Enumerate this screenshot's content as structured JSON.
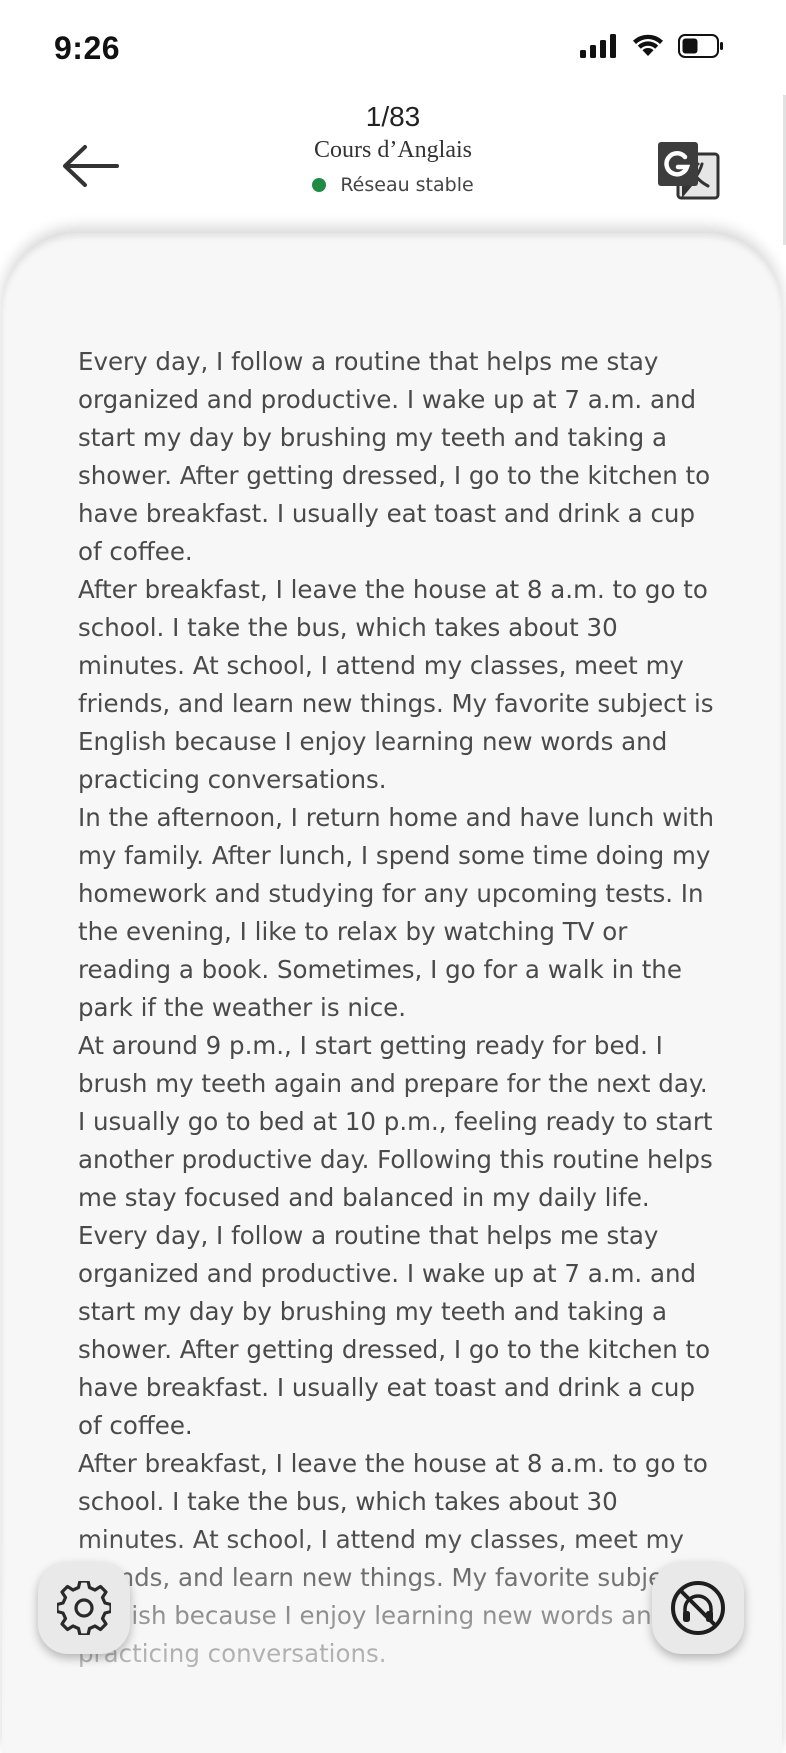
{
  "status_bar": {
    "time": "9:26",
    "icons": [
      "signal-icon",
      "wifi-icon",
      "battery-icon"
    ]
  },
  "header": {
    "page_counter": "1/83",
    "course_title": "Cours d’Anglais",
    "network_status": "Réseau stable",
    "network_status_color": "#1e8c45",
    "back_icon": "back-arrow-icon",
    "translate_icon": "google-translate-icon"
  },
  "reader": {
    "paragraphs": [
      "Every day, I follow a routine that helps me stay organized and productive. I wake up at 7 a.m. and start my day by brushing my teeth and taking a shower. After getting dressed, I go to the kitchen to have breakfast. I usually eat toast and drink a cup of coffee.",
      "After breakfast, I leave the house at 8 a.m. to go to school. I take the bus, which takes about 30 minutes. At school, I attend my classes, meet my friends, and learn new things. My favorite subject is English because I enjoy learning new words and practicing conversations.",
      "In the afternoon, I return home and have lunch with my family. After lunch, I spend some time doing my homework and studying for any upcoming tests. In the evening, I like to relax by watching TV or reading a book. Sometimes, I go for a walk in the park if the weather is nice.",
      "At around 9 p.m., I start getting ready for bed. I brush my teeth again and prepare for the next day. I usually go to bed at 10 p.m., feeling ready to start another productive day. Following this routine helps me stay focused and balanced in my daily life.",
      "Every day, I follow a routine that helps me stay organized and productive. I wake up at 7 a.m. and start my day by brushing my teeth and taking a shower. After getting dressed, I go to the kitchen to have breakfast. I usually eat toast and drink a cup of coffee.",
      "After breakfast, I leave the house at 8 a.m. to go to school. I take the bus, which takes about 30 minutes. At school, I attend my classes, meet my friends, and learn new things. My favorite subject is English because I enjoy learning new words and practicing conversations."
    ]
  },
  "controls": {
    "settings_icon": "gear-icon",
    "audio_icon": "headphones-off-icon"
  }
}
